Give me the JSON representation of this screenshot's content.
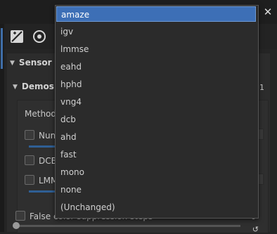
{
  "panel": {
    "sensor_header": "Sensor w",
    "demosaic_header": "Demos",
    "method_label": "Method:",
    "rows": [
      {
        "label": "Numb"
      },
      {
        "label": "DCB e"
      },
      {
        "label": "LMMS"
      }
    ],
    "bottom_row_label": "False color suppression steps",
    "bottom_row_value": "0",
    "right_edge_value": "1"
  },
  "dropdown": {
    "selected_index": 0,
    "options": [
      "amaze",
      "igv",
      "lmmse",
      "eahd",
      "hphd",
      "vng4",
      "dcb",
      "ahd",
      "fast",
      "mono",
      "none",
      "(Unchanged)"
    ]
  },
  "icons": {
    "close": "close-icon",
    "tool1": "curve-edit-icon",
    "tool2": "circle-refresh-icon"
  },
  "colors": {
    "accent": "#3d6fb6"
  }
}
